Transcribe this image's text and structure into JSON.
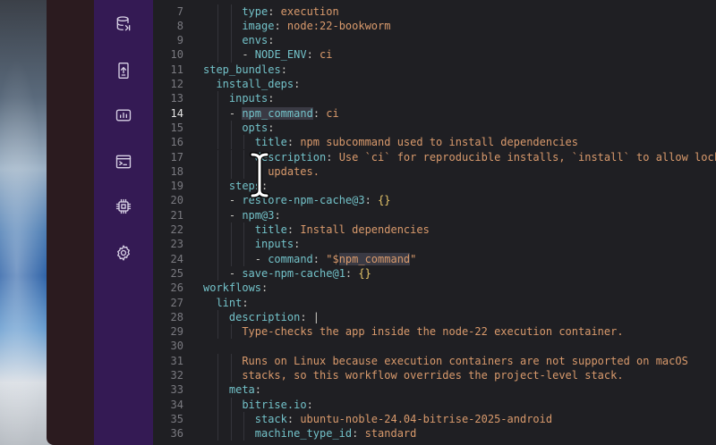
{
  "sidebar": {
    "items": [
      {
        "name": "database-icon"
      },
      {
        "name": "mobile-upload-icon"
      },
      {
        "name": "dashboard-icon"
      },
      {
        "name": "terminal-icon"
      },
      {
        "name": "chip-icon"
      },
      {
        "name": "settings-icon"
      }
    ]
  },
  "editor": {
    "active_line": "14",
    "lines": [
      {
        "n": "7",
        "indent": 3,
        "parts": [
          [
            "k",
            "type"
          ],
          [
            "p",
            ": "
          ],
          [
            "s",
            "execution"
          ]
        ]
      },
      {
        "n": "8",
        "indent": 3,
        "parts": [
          [
            "k",
            "image"
          ],
          [
            "p",
            ": "
          ],
          [
            "s",
            "node:22-bookworm"
          ]
        ]
      },
      {
        "n": "9",
        "indent": 3,
        "parts": [
          [
            "k",
            "envs"
          ],
          [
            "p",
            ":"
          ]
        ]
      },
      {
        "n": "10",
        "indent": 3,
        "parts": [
          [
            "p",
            "- "
          ],
          [
            "k",
            "NODE_ENV"
          ],
          [
            "p",
            ": "
          ],
          [
            "s",
            "ci"
          ]
        ]
      },
      {
        "n": "11",
        "indent": 0,
        "parts": [
          [
            "k",
            "step_bundles"
          ],
          [
            "p",
            ":"
          ]
        ]
      },
      {
        "n": "12",
        "indent": 1,
        "parts": [
          [
            "k",
            "install_deps"
          ],
          [
            "p",
            ":"
          ]
        ]
      },
      {
        "n": "13",
        "indent": 2,
        "parts": [
          [
            "k",
            "inputs"
          ],
          [
            "p",
            ":"
          ]
        ]
      },
      {
        "n": "14",
        "indent": 2,
        "parts": [
          [
            "p",
            "- "
          ],
          [
            "khl",
            "npm_command"
          ],
          [
            "p",
            ": "
          ],
          [
            "s",
            "ci"
          ]
        ]
      },
      {
        "n": "15",
        "indent": 3,
        "parts": [
          [
            "k",
            "opts"
          ],
          [
            "p",
            ":"
          ]
        ]
      },
      {
        "n": "16",
        "indent": 4,
        "parts": [
          [
            "k",
            "title"
          ],
          [
            "p",
            ": "
          ],
          [
            "s",
            "npm subcommand used to install dependencies"
          ]
        ]
      },
      {
        "n": "17",
        "indent": 4,
        "parts": [
          [
            "k",
            "description"
          ],
          [
            "p",
            ": "
          ],
          [
            "s",
            "Use `ci` for reproducible installs, `install` to allow lockfile"
          ]
        ]
      },
      {
        "n": "18",
        "indent": 5,
        "parts": [
          [
            "s",
            "updates."
          ]
        ]
      },
      {
        "n": "19",
        "indent": 2,
        "parts": [
          [
            "k",
            "steps"
          ],
          [
            "p",
            ":"
          ]
        ]
      },
      {
        "n": "20",
        "indent": 2,
        "parts": [
          [
            "p",
            "- "
          ],
          [
            "k",
            "restore-npm-cache@3"
          ],
          [
            "p",
            ": "
          ],
          [
            "b",
            "{}"
          ]
        ]
      },
      {
        "n": "21",
        "indent": 2,
        "parts": [
          [
            "p",
            "- "
          ],
          [
            "k",
            "npm@3"
          ],
          [
            "p",
            ":"
          ]
        ]
      },
      {
        "n": "22",
        "indent": 4,
        "parts": [
          [
            "k",
            "title"
          ],
          [
            "p",
            ": "
          ],
          [
            "s",
            "Install dependencies"
          ]
        ]
      },
      {
        "n": "23",
        "indent": 4,
        "parts": [
          [
            "k",
            "inputs"
          ],
          [
            "p",
            ":"
          ]
        ]
      },
      {
        "n": "24",
        "indent": 4,
        "parts": [
          [
            "p",
            "- "
          ],
          [
            "k",
            "command"
          ],
          [
            "p",
            ": "
          ],
          [
            "s",
            "\"$"
          ],
          [
            "shl",
            "npm_command"
          ],
          [
            "s",
            "\""
          ]
        ]
      },
      {
        "n": "25",
        "indent": 2,
        "parts": [
          [
            "p",
            "- "
          ],
          [
            "k",
            "save-npm-cache@1"
          ],
          [
            "p",
            ": "
          ],
          [
            "b",
            "{}"
          ]
        ]
      },
      {
        "n": "26",
        "indent": 0,
        "parts": [
          [
            "k",
            "workflows"
          ],
          [
            "p",
            ":"
          ]
        ]
      },
      {
        "n": "27",
        "indent": 1,
        "parts": [
          [
            "k",
            "lint"
          ],
          [
            "p",
            ":"
          ]
        ]
      },
      {
        "n": "28",
        "indent": 2,
        "parts": [
          [
            "k",
            "description"
          ],
          [
            "p",
            ": |"
          ]
        ]
      },
      {
        "n": "29",
        "indent": 3,
        "parts": [
          [
            "s",
            "Type-checks the app inside the node-22 execution container."
          ]
        ]
      },
      {
        "n": "30",
        "indent": 0,
        "parts": []
      },
      {
        "n": "31",
        "indent": 3,
        "parts": [
          [
            "s",
            "Runs on Linux because execution containers are not supported on macOS"
          ]
        ]
      },
      {
        "n": "32",
        "indent": 3,
        "parts": [
          [
            "s",
            "stacks, so this workflow overrides the project-level stack."
          ]
        ]
      },
      {
        "n": "33",
        "indent": 2,
        "parts": [
          [
            "k",
            "meta"
          ],
          [
            "p",
            ":"
          ]
        ]
      },
      {
        "n": "34",
        "indent": 3,
        "parts": [
          [
            "k",
            "bitrise.io"
          ],
          [
            "p",
            ":"
          ]
        ]
      },
      {
        "n": "35",
        "indent": 4,
        "parts": [
          [
            "k",
            "stack"
          ],
          [
            "p",
            ": "
          ],
          [
            "s",
            "ubuntu-noble-24.04-bitrise-2025-android"
          ]
        ]
      },
      {
        "n": "36",
        "indent": 4,
        "parts": [
          [
            "k",
            "machine_type_id"
          ],
          [
            "p",
            ": "
          ],
          [
            "s",
            "standard"
          ]
        ]
      }
    ]
  }
}
